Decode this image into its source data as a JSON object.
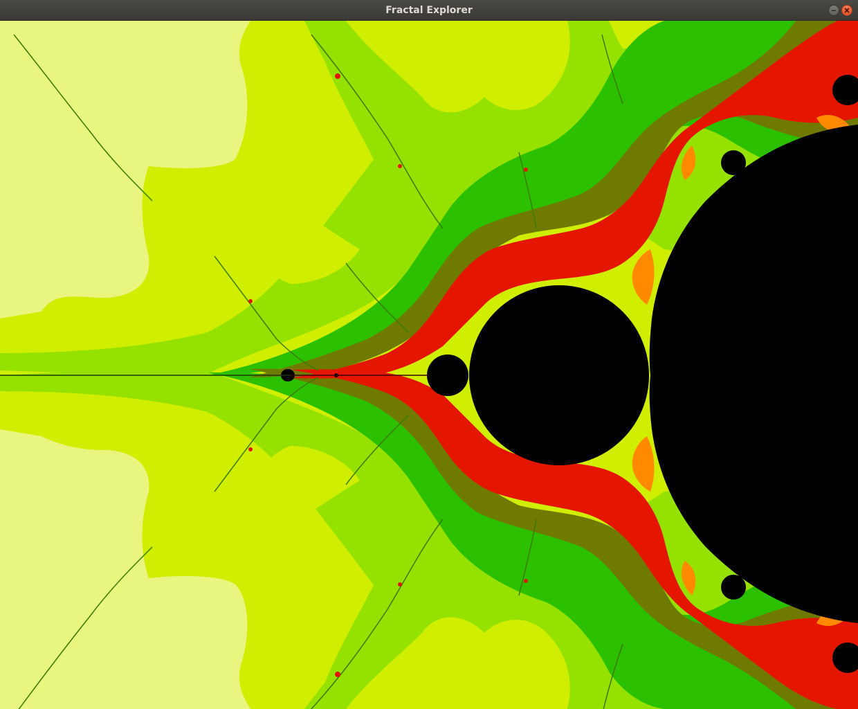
{
  "window": {
    "title": "Fractal Explorer",
    "buttons": {
      "minimize_icon": "minimize-icon",
      "close_icon": "close-icon"
    }
  },
  "fractal": {
    "type": "mandelbrot",
    "palette": {
      "background": "#000000",
      "band_1": "#e8f57e",
      "band_2": "#cfee00",
      "band_3": "#95e100",
      "band_4": "#2cc100",
      "band_5": "#6f7b00",
      "band_6": "#e51600",
      "band_7": "#ff8a00",
      "set_interior": "#000000"
    }
  }
}
